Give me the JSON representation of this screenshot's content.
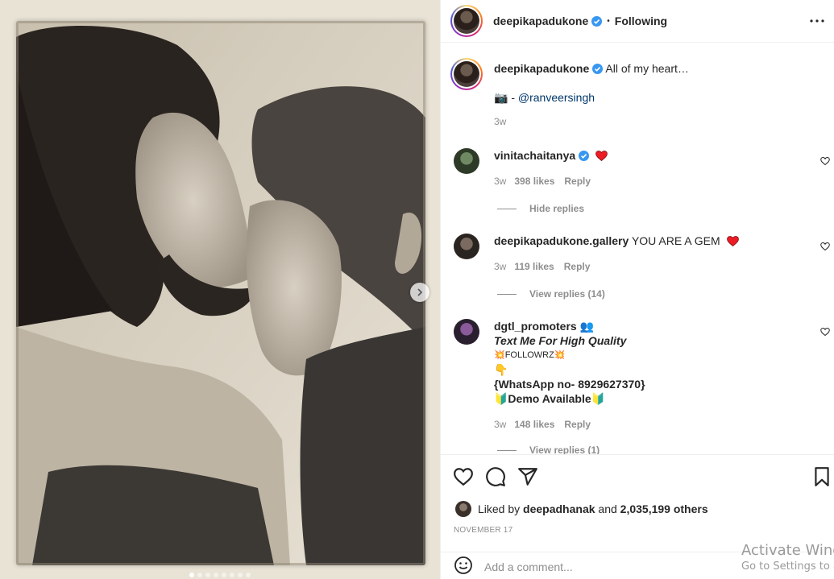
{
  "post": {
    "author": "deepikapadukone",
    "follow_status": "Following",
    "caption": "All of my heart…",
    "credit_prefix": "📷 - ",
    "credit_handle": "@ranveersingh",
    "caption_age": "3w"
  },
  "media": {
    "slide_count": 8,
    "active_slide": 1
  },
  "comments": [
    {
      "user": "vinitachaitanya",
      "verified": true,
      "text": "",
      "emoji": "red-heart",
      "age": "3w",
      "likes": "398 likes",
      "reply_label": "Reply",
      "replies_toggle": "Hide replies"
    },
    {
      "user": "deepikapadukone.gallery",
      "verified": false,
      "text": "YOU ARE A GEM",
      "emoji": "red-heart",
      "age": "3w",
      "likes": "119 likes",
      "reply_label": "Reply",
      "replies_toggle": "View replies (14)"
    },
    {
      "user": "dgtl_promoters",
      "verified": false,
      "text_emoji": "👥",
      "lines": [
        "Text Me For High Quality",
        "💥FOLLOWRZ💥",
        "👇",
        "{WhatsApp no- 8929627370}",
        "🔰Demo Available🔰"
      ],
      "age": "3w",
      "likes": "148 likes",
      "reply_label": "Reply",
      "replies_toggle": "View replies (1)"
    }
  ],
  "actions": {
    "liked_by_prefix": "Liked by ",
    "liked_by_user": "deepadhanak",
    "liked_by_mid": " and ",
    "liked_by_count": "2,035,199 others",
    "date": "NOVEMBER 17",
    "comment_placeholder": "Add a comment..."
  },
  "watermark": {
    "line1": "Activate Windows",
    "line2": "Go to Settings to activate Windows."
  },
  "colors": {
    "verified": "#3897f0",
    "heart_red": "#ed4956",
    "link": "#00376b",
    "muted": "#8e8e8e"
  }
}
